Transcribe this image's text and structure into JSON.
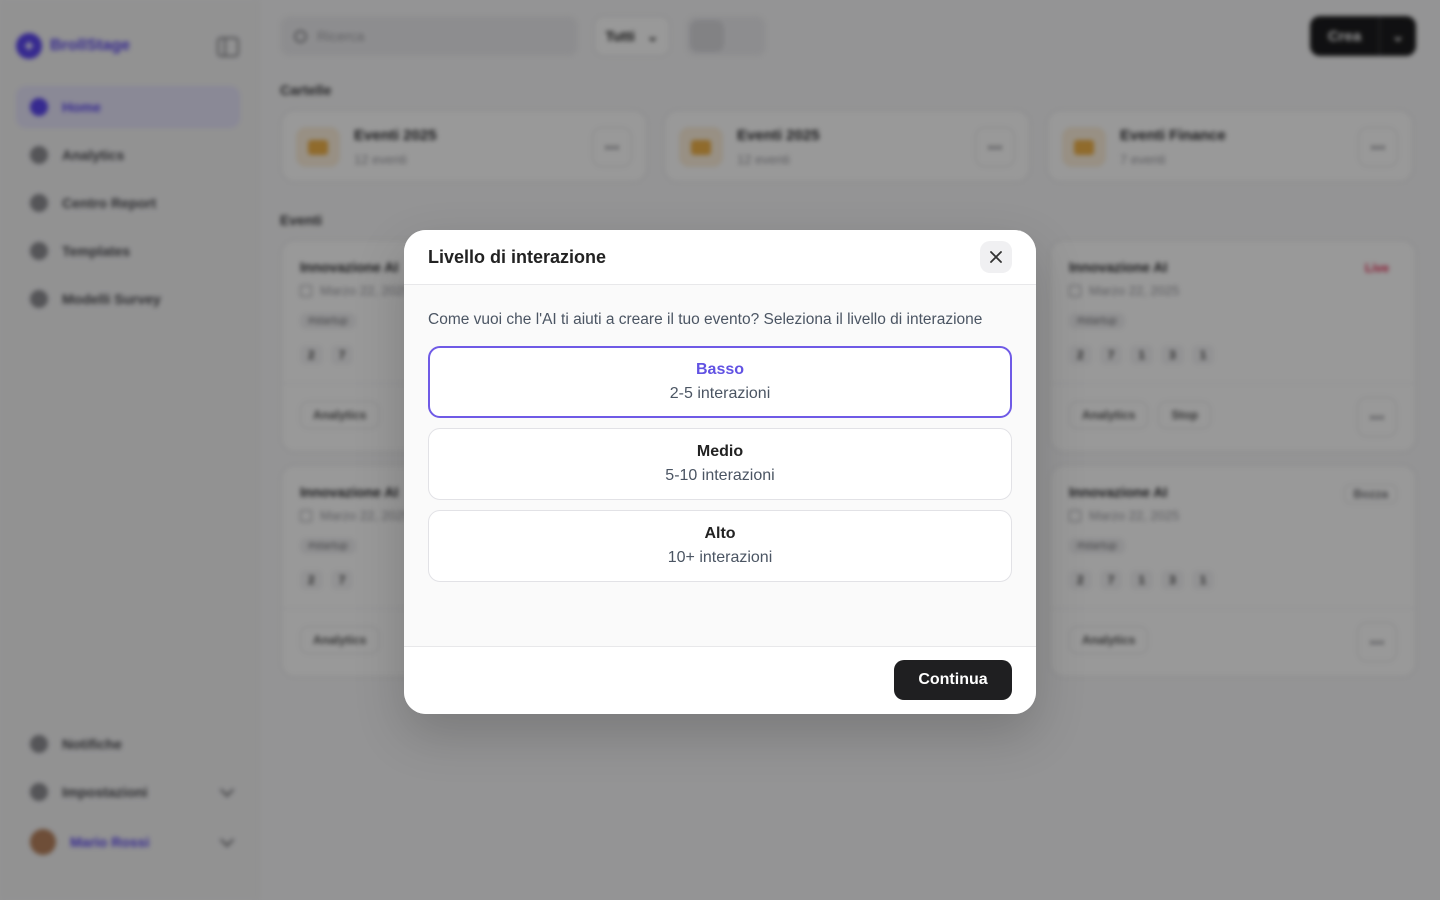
{
  "sidebar": {
    "brand": "BrollStage",
    "nav": [
      {
        "label": "Home",
        "icon": "home-icon",
        "active": true
      },
      {
        "label": "Analytics",
        "icon": "analytics-icon"
      },
      {
        "label": "Centro Report",
        "icon": "report-icon"
      },
      {
        "label": "Templates",
        "icon": "templates-icon"
      },
      {
        "label": "Modelli Survey",
        "icon": "survey-icon"
      }
    ],
    "notifications": "Notifiche",
    "settings": "Impostazioni",
    "user": "Mario Rossi"
  },
  "topbar": {
    "search_placeholder": "Ricerca",
    "filter": "Tutti",
    "create": "Crea"
  },
  "folders": {
    "label": "Cartelle",
    "items": [
      {
        "name": "Eventi 2025",
        "count": "12 eventi"
      },
      {
        "name": "Eventi 2025",
        "count": "12 eventi"
      },
      {
        "name": "Eventi Finance",
        "count": "7 eventi"
      }
    ]
  },
  "events": {
    "label": "Eventi",
    "cards": [
      {
        "title": "Innovazione AI",
        "date": "Marzo 22, 2025",
        "tag": "#startup",
        "stats": [
          "2",
          "7",
          "1",
          "3",
          "1"
        ],
        "status": "",
        "actions": [
          "Analytics"
        ]
      },
      {
        "title": "Innovazione AI",
        "date": "Marzo 22, 2025",
        "tag": "#startup",
        "stats": [
          "2",
          "7",
          "1",
          "3",
          "1"
        ],
        "status": "Live",
        "actions": [
          "Analytics",
          "Stop"
        ]
      },
      {
        "title": "Innovazione AI",
        "date": "Marzo 22, 2025",
        "tag": "#startup",
        "stats": [
          "2",
          "7",
          "1",
          "3",
          "1"
        ],
        "status": "",
        "actions": [
          "Analytics"
        ]
      },
      {
        "title": "Innovazione AI",
        "date": "Marzo 22, 2025",
        "tag": "#startup",
        "stats": [
          "2",
          "7",
          "1",
          "3",
          "1"
        ],
        "status": "Bozza",
        "actions": [
          "Analytics"
        ]
      }
    ]
  },
  "modal": {
    "title": "Livello di interazione",
    "description": "Come vuoi che l'AI ti aiuti a creare il tuo evento? Seleziona il livello di interazione",
    "options": [
      {
        "title": "Basso",
        "subtitle": "2-5 interazioni",
        "selected": true
      },
      {
        "title": "Medio",
        "subtitle": "5-10 interazioni",
        "selected": false
      },
      {
        "title": "Alto",
        "subtitle": "10+ interazioni",
        "selected": false
      }
    ],
    "continue": "Continua"
  },
  "colors": {
    "accent": "#6152e3",
    "primary_button": "#1f1f21",
    "overlay": "rgba(0,0,0,0.40)"
  }
}
